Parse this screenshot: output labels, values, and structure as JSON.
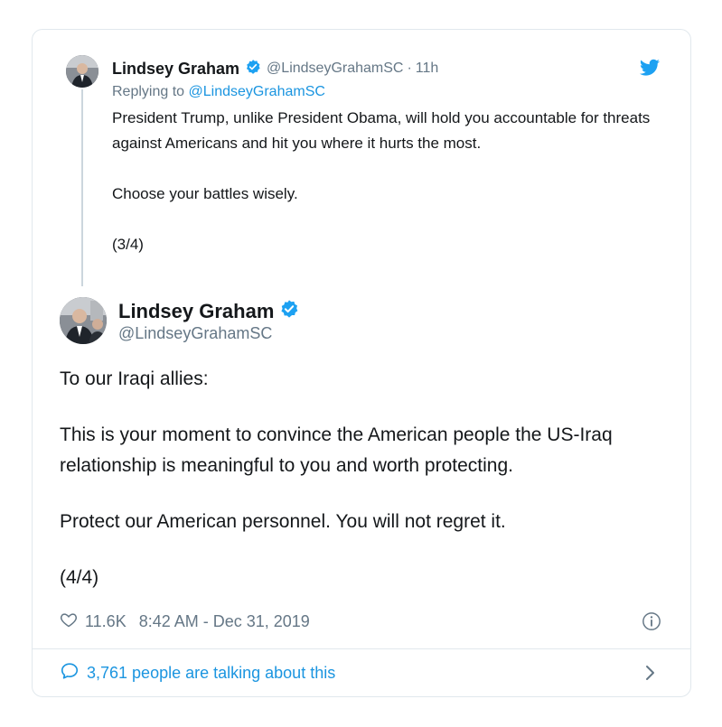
{
  "parent_tweet": {
    "author_name": "Lindsey Graham",
    "handle": "@LindseyGrahamSC",
    "separator": "·",
    "time": "11h",
    "replying_prefix": "Replying to",
    "replying_to": "@LindseyGrahamSC",
    "paragraphs": [
      "President Trump, unlike President Obama, will hold you accountable for threats against Americans and hit you where it hurts the most.",
      "Choose your battles wisely.",
      "(3/4)"
    ]
  },
  "main_tweet": {
    "author_name": "Lindsey Graham",
    "handle": "@LindseyGrahamSC",
    "paragraphs": [
      "To our Iraqi allies:",
      "This is your moment to convince the American people the US-Iraq relationship is meaningful to you and worth protecting.",
      "Protect our American personnel. You will not regret it.",
      "(4/4)"
    ],
    "likes": "11.6K",
    "timestamp": "8:42 AM - Dec 31, 2019"
  },
  "footer": {
    "talking_text": "3,761 people are talking about this"
  },
  "icons": {
    "verified": "verified-badge-icon",
    "bird": "twitter-bird-icon",
    "heart": "heart-icon",
    "info": "info-icon",
    "comment": "speech-bubble-icon",
    "chevron": "chevron-right-icon"
  },
  "colors": {
    "text": "#14171a",
    "secondary": "#657786",
    "link": "#1b95e0",
    "verified": "#1da1f2",
    "border": "#e1e8ed"
  }
}
